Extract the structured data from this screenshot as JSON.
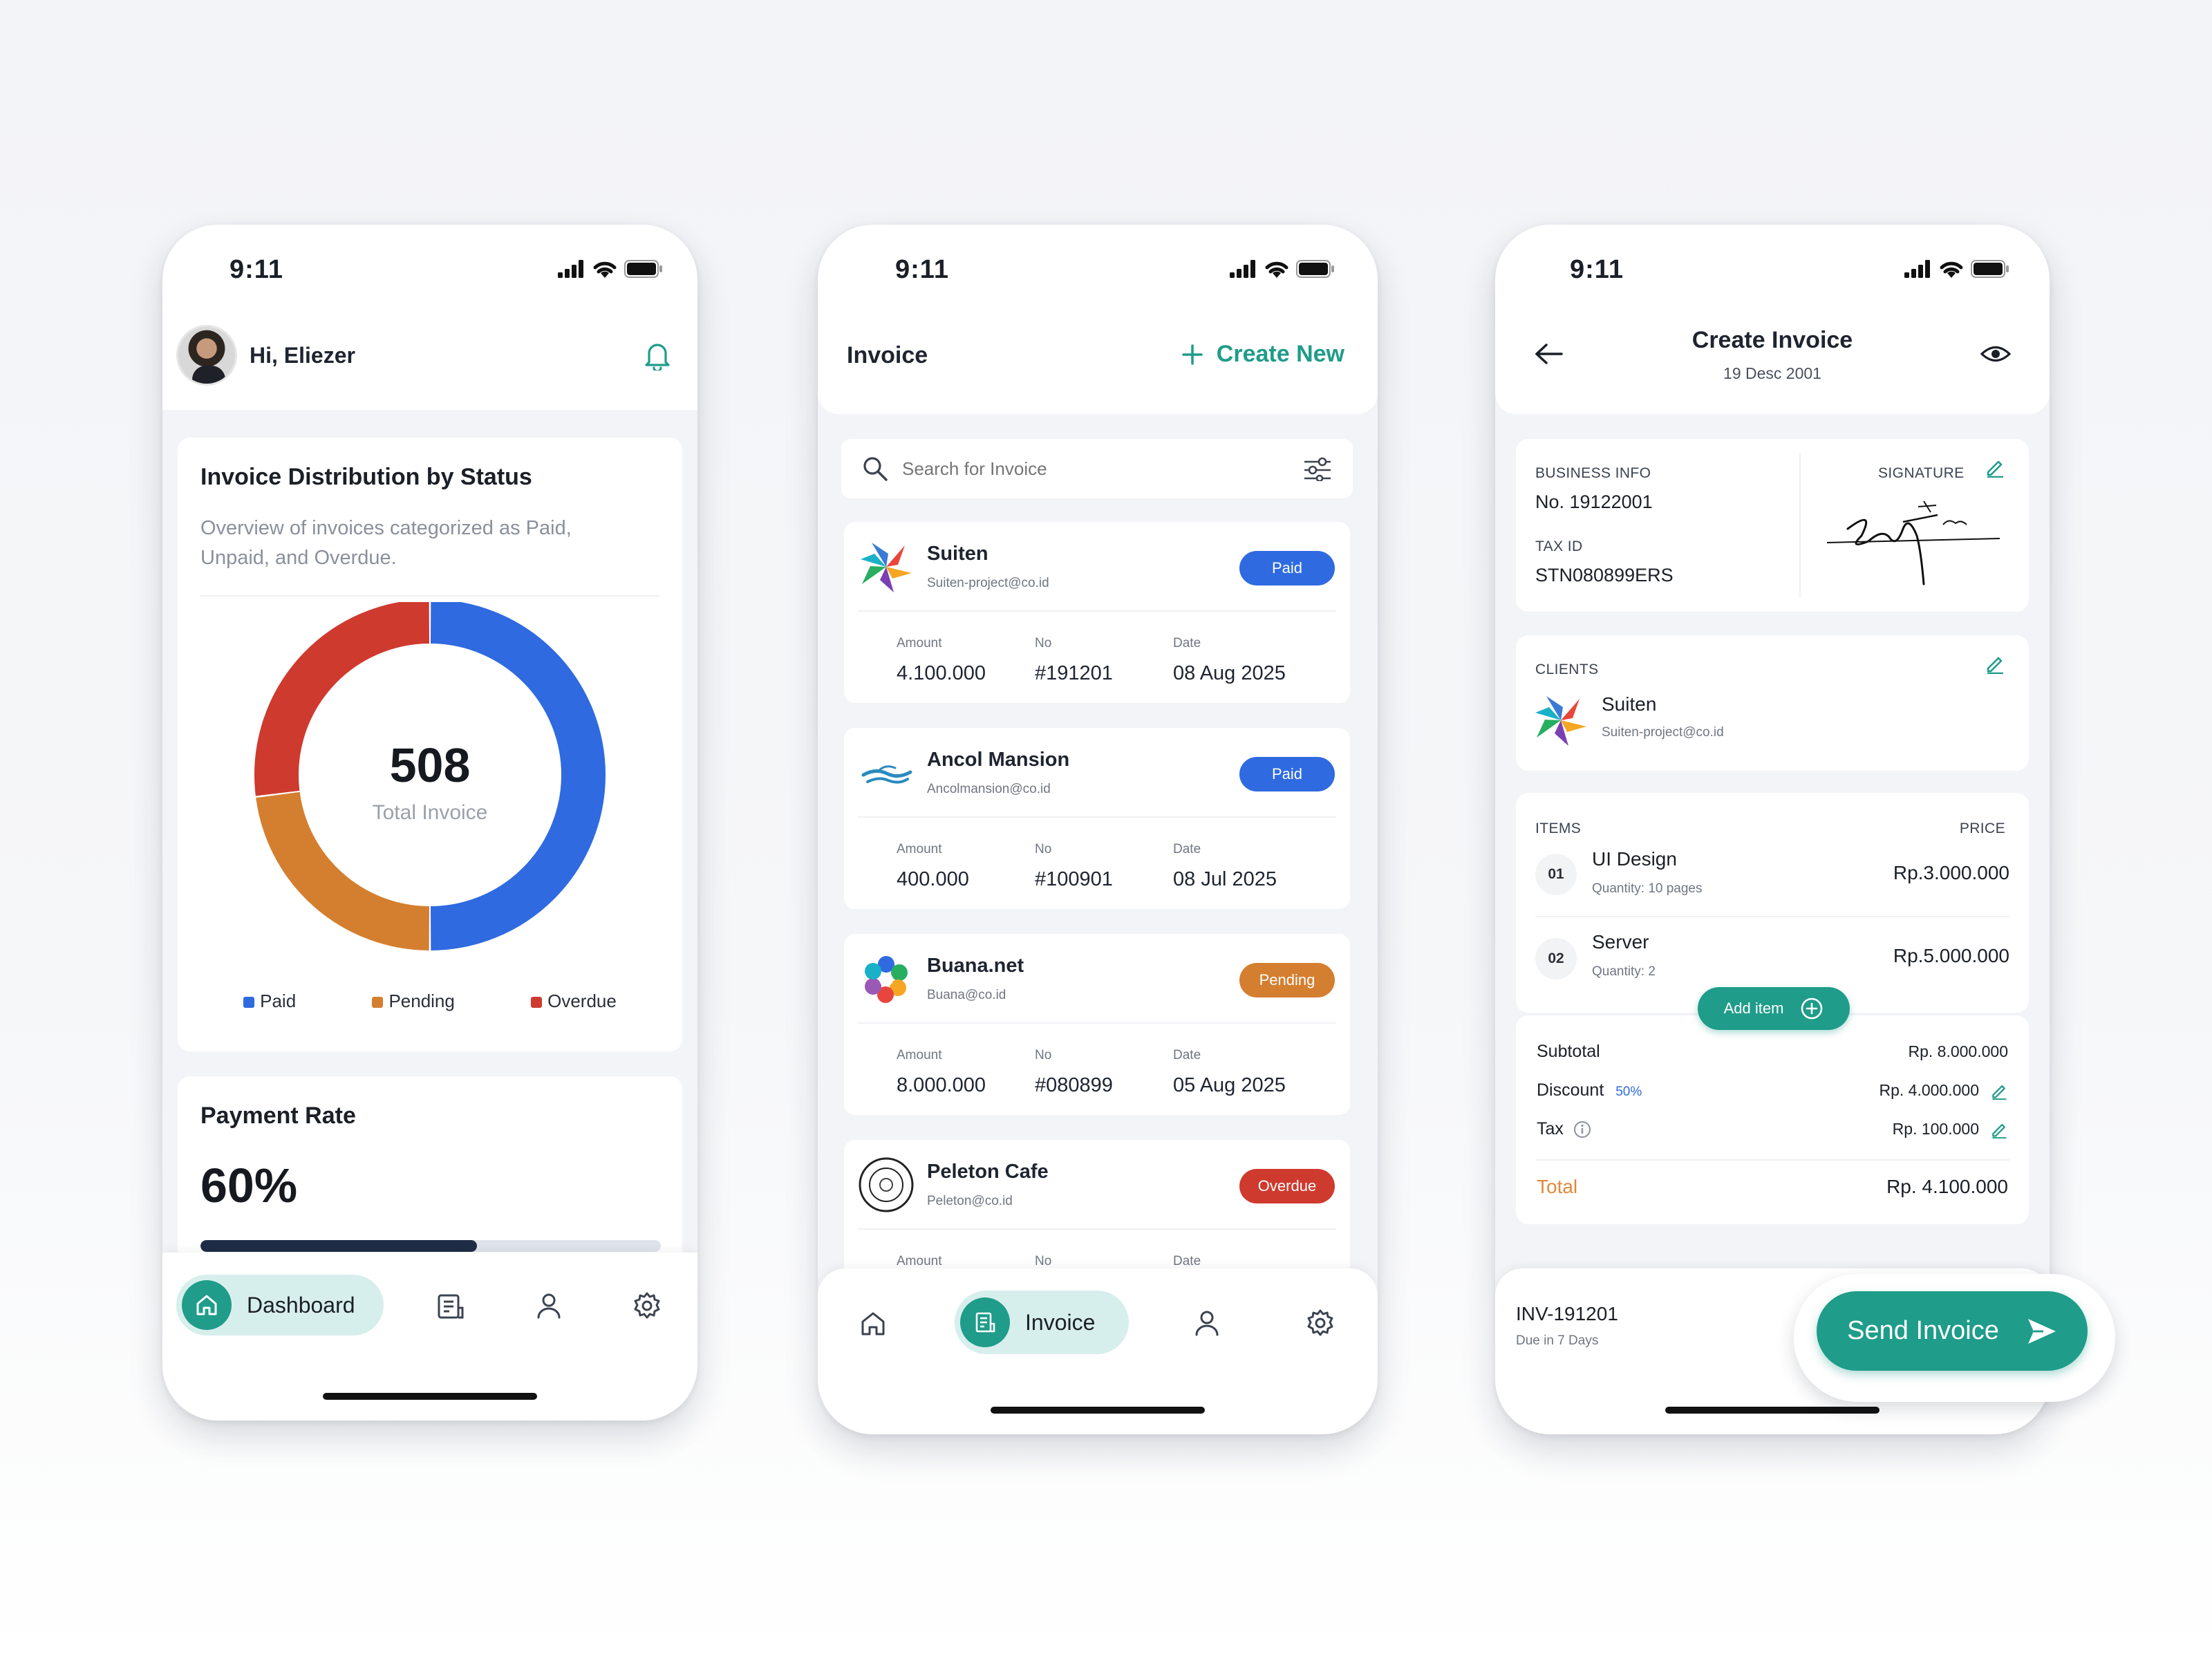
{
  "colors": {
    "accent": "#1f9c8a",
    "paid": "#2f6ae0",
    "pending": "#d47f2f",
    "overdue": "#cf3a2e",
    "progress": "#1f2c46",
    "total_label": "#e0893a"
  },
  "status_bar": {
    "time": "9:11"
  },
  "dashboard": {
    "greeting": "Hi, Eliezer",
    "distribution_card": {
      "title": "Invoice Distribution by Status",
      "subtitle": "Overview of invoices categorized as Paid, Unpaid, and Overdue.",
      "total_value": "508",
      "total_label": "Total Invoice",
      "legend": [
        "Paid",
        "Pending",
        "Overdue"
      ]
    },
    "payment_rate": {
      "title": "Payment Rate",
      "value": "60%",
      "progress_fraction": 0.6
    },
    "nav": {
      "active_label": "Dashboard"
    }
  },
  "chart_data": {
    "type": "pie",
    "title": "Invoice Distribution by Status",
    "categories": [
      "Paid",
      "Pending",
      "Overdue"
    ],
    "values": [
      50,
      23,
      27
    ],
    "colors": [
      "#2f6ae0",
      "#d47f2f",
      "#cf3a2e"
    ]
  },
  "invoice_list": {
    "title": "Invoice",
    "create_new": "Create New",
    "search_placeholder": "Search for Invoice",
    "field_labels": {
      "amount": "Amount",
      "no": "No",
      "date": "Date"
    },
    "items": [
      {
        "name": "Suiten",
        "email": "Suiten-project@co.id",
        "status": "Paid",
        "amount": "4.100.000",
        "no": "#191201",
        "date": "08 Aug 2025"
      },
      {
        "name": "Ancol Mansion",
        "email": "Ancolmansion@co.id",
        "status": "Paid",
        "amount": "400.000",
        "no": "#100901",
        "date": "08 Jul 2025"
      },
      {
        "name": "Buana.net",
        "email": "Buana@co.id",
        "status": "Pending",
        "amount": "8.000.000",
        "no": "#080899",
        "date": "05 Aug 2025"
      },
      {
        "name": "Peleton Cafe",
        "email": "Peleton@co.id",
        "status": "Overdue",
        "amount": "",
        "no": "",
        "date": ""
      }
    ],
    "nav": {
      "active_label": "Invoice"
    }
  },
  "create_invoice": {
    "title": "Create Invoice",
    "date": "19 Desc 2001",
    "business_info": {
      "label": "BUSINESS INFO",
      "number": "No. 19122001",
      "tax_label": "TAX ID",
      "tax_id": "STN080899ERS",
      "signature_label": "SIGNATURE"
    },
    "clients": {
      "label": "CLIENTS",
      "name": "Suiten",
      "email": "Suiten-project@co.id"
    },
    "items": {
      "label": "ITEMS",
      "price_label": "PRICE",
      "rows": [
        {
          "index": "01",
          "name": "UI Design",
          "quantity": "Quantity: 10 pages",
          "price": "Rp.3.000.000"
        },
        {
          "index": "02",
          "name": "Server",
          "quantity": "Quantity: 2",
          "price": "Rp.5.000.000"
        }
      ],
      "add_item": "Add item"
    },
    "summary": {
      "subtotal_label": "Subtotal",
      "subtotal": "Rp. 8.000.000",
      "discount_label": "Discount",
      "discount_pct": "50%",
      "discount": "Rp. 4.000.000",
      "tax_label": "Tax",
      "tax": "Rp. 100.000",
      "total_label": "Total",
      "total": "Rp. 4.100.000"
    },
    "footer": {
      "invoice_id": "INV-191201",
      "due": "Due in 7 Days",
      "send_label": "Send Invoice"
    }
  }
}
